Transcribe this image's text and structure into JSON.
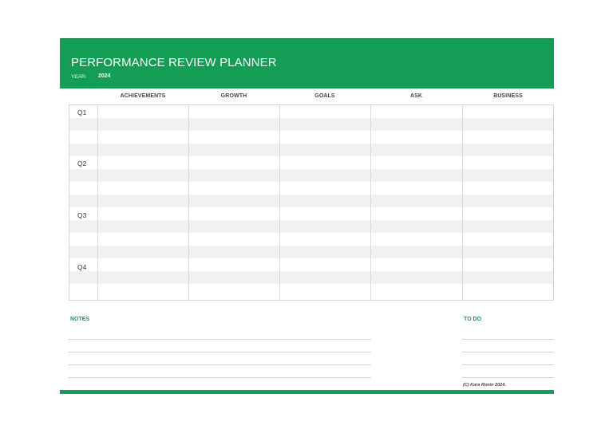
{
  "header": {
    "title": "PERFORMANCE REVIEW PLANNER",
    "year_label": "YEAR:",
    "year_value": "2024"
  },
  "columns": [
    "ACHIEVEMENTS",
    "GROWTH",
    "GOALS",
    "ASK",
    "BUSINESS"
  ],
  "quarters": [
    "Q1",
    "Q2",
    "Q3",
    "Q4"
  ],
  "notes": {
    "label": "NOTES"
  },
  "todo": {
    "label": "TO DO"
  },
  "footer": {
    "copyright": "(C) Kara Ronin 2024."
  },
  "colors": {
    "accent": "#149e55",
    "row_shade": "#f1f1f1",
    "grid_line": "#d9d9d9"
  }
}
